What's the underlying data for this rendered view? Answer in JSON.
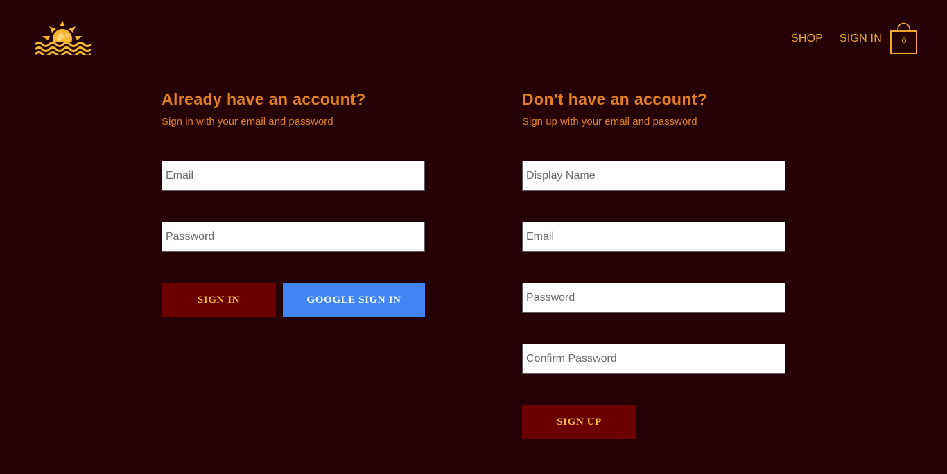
{
  "header": {
    "logo_icon": "sun-over-waves-logo-icon",
    "nav": {
      "shop_label": "SHOP",
      "signin_label": "SIGN IN"
    },
    "cart": {
      "icon": "shopping-bag-icon",
      "count": "0"
    }
  },
  "sign_in": {
    "title": "Already have an account?",
    "subtitle": "Sign in with your email and password",
    "email_placeholder": "Email",
    "email_value": "",
    "password_placeholder": "Password",
    "password_value": "",
    "signin_button": "SIGN IN",
    "google_button": "GOOGLE SIGN IN"
  },
  "sign_up": {
    "title": "Don't have an account?",
    "subtitle": "Sign up with your email and password",
    "display_name_placeholder": "Display Name",
    "email_placeholder": "Email",
    "password_placeholder": "Password",
    "confirm_password_placeholder": "Confirm Password",
    "signup_button": "SIGN UP"
  },
  "colors": {
    "background": "#250005",
    "accent_gold": "#f0a52b",
    "heading_orange": "#e0801f",
    "button_dark": "#6a0000",
    "button_google": "#4285f4"
  }
}
